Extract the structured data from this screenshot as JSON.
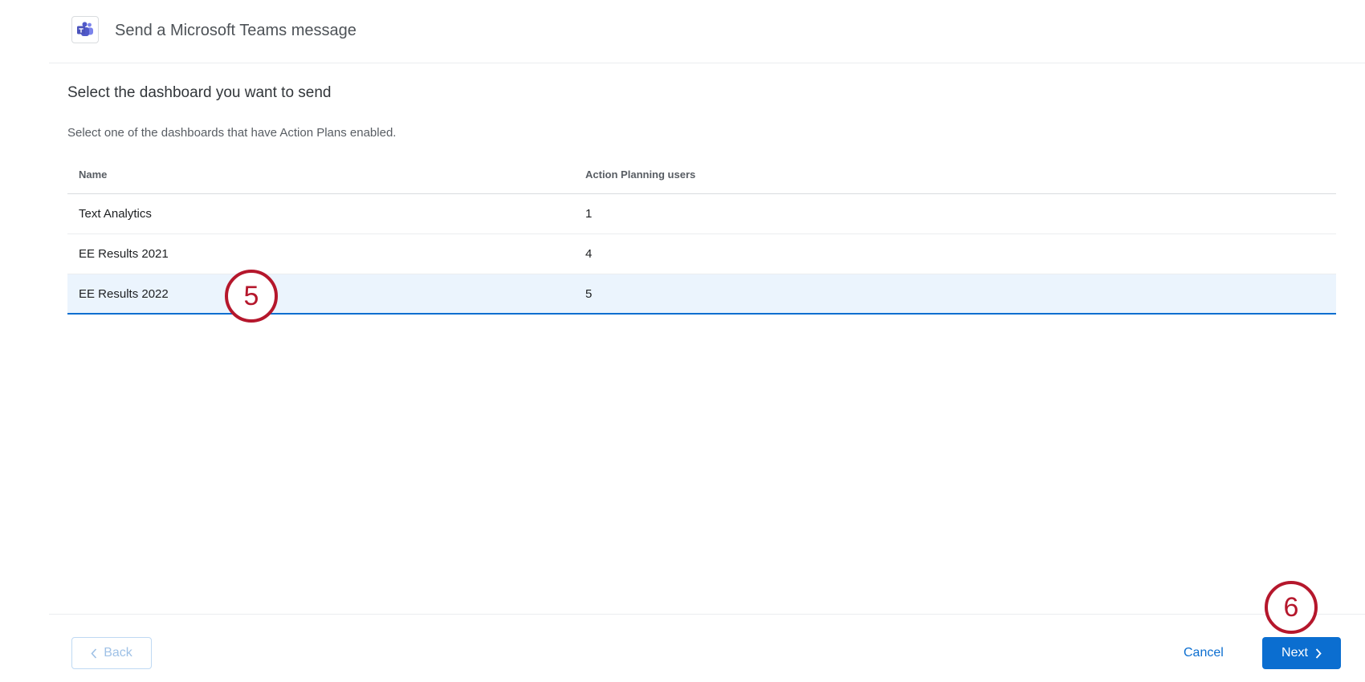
{
  "header": {
    "title": "Send a Microsoft Teams message",
    "logo_icon": "microsoft-teams-logo-icon"
  },
  "main": {
    "title": "Select the dashboard you want to send",
    "description": "Select one of the dashboards that have Action Plans enabled."
  },
  "table": {
    "columns": [
      "Name",
      "Action Planning users"
    ],
    "rows": [
      {
        "name": "Text Analytics",
        "users": "1"
      },
      {
        "name": "EE Results 2021",
        "users": "4"
      },
      {
        "name": "EE Results 2022",
        "users": "5"
      }
    ],
    "selected_row": 2
  },
  "callouts": [
    "5",
    "6"
  ],
  "footer": {
    "back_label": "Back",
    "cancel_label": "Cancel",
    "next_label": "Next"
  },
  "colors": {
    "accent": "#0b6ed0",
    "selected_row_bg": "#ebf4fd",
    "callout": "#b5172c",
    "teams_brand": "#5059c9"
  }
}
